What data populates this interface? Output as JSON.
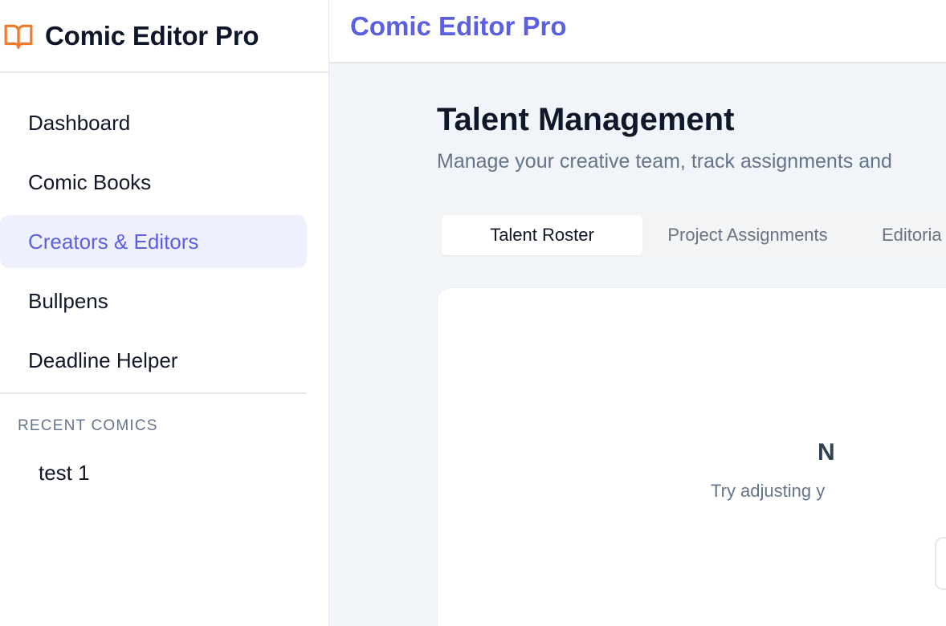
{
  "app": {
    "name": "Comic Editor Pro",
    "accent_color": "#5b5fe0",
    "brand_icon": "open-book-icon",
    "brand_icon_color": "#f07a2e"
  },
  "topbar": {
    "title": "Comic Editor Pro"
  },
  "sidebar": {
    "items": [
      {
        "label": "Dashboard",
        "active": false
      },
      {
        "label": "Comic Books",
        "active": false
      },
      {
        "label": "Creators & Editors",
        "active": true
      },
      {
        "label": "Bullpens",
        "active": false
      },
      {
        "label": "Deadline Helper",
        "active": false
      }
    ],
    "recent_section_label": "RECENT COMICS",
    "recent_items": [
      {
        "label": "test 1"
      }
    ]
  },
  "main": {
    "title": "Talent Management",
    "subtitle": "Manage your creative team, track assignments and",
    "tabs": [
      {
        "label": "Talent Roster",
        "active": true
      },
      {
        "label": "Project Assignments",
        "active": false
      },
      {
        "label": "Editoria",
        "active": false
      }
    ],
    "empty_state": {
      "title": "N",
      "hint": "Try adjusting y"
    }
  }
}
